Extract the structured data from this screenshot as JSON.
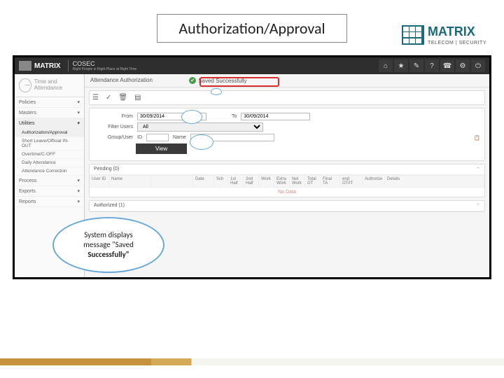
{
  "slide": {
    "title": "Authorization/Approval"
  },
  "brand": {
    "name": "MATRIX",
    "sub": "TELECOM | SECURITY"
  },
  "app": {
    "logo_name": "MATRIX",
    "product": "COSEC",
    "tagline": "Right People in Right Place at Right Time",
    "module_title": "Time and\nAttendance"
  },
  "top_icons": [
    "⌂",
    "★",
    "✎",
    "?",
    "☎",
    "⚙",
    "⏻"
  ],
  "sidebar": {
    "sections": [
      {
        "label": "Policies",
        "items": []
      },
      {
        "label": "Masters",
        "items": []
      },
      {
        "label": "Utilities",
        "active": true,
        "items": [
          {
            "label": "Authorization/Approval",
            "active": true
          },
          {
            "label": "Short Leave/Official IN-OUT"
          },
          {
            "label": "Overtime/C-OFF"
          },
          {
            "label": "Daily Attendance"
          },
          {
            "label": "Attendance Correction"
          }
        ]
      },
      {
        "label": "Process",
        "items": []
      },
      {
        "label": "Exports",
        "items": []
      },
      {
        "label": "Reports",
        "items": []
      }
    ]
  },
  "breadcrumb": "Attendance Authorization",
  "saved_msg": "Saved Successfully",
  "toolbar": [
    "☰",
    "✓",
    "🗑",
    "▤"
  ],
  "filters": {
    "from_label": "From",
    "from_value": "30/09/2014",
    "to_label": "To",
    "to_value": "30/09/2014",
    "filter_users_label": "Filter Users",
    "filter_users_value": "All",
    "group_user_label": "Group/User",
    "id_label": "ID",
    "name_label": "Name",
    "view_btn": "View"
  },
  "pending": {
    "title": "Pending (0)",
    "cols": [
      "User ID",
      "Name",
      "",
      "Date",
      "Sch",
      "1st Half",
      "2nd Half",
      "Work",
      "Extra Work",
      "Net Work",
      "Total OT",
      "Final TA",
      "end OT/IT",
      "Authorize",
      "Details"
    ],
    "nodata": "No Data"
  },
  "authorized": {
    "title": "Authorized (1)"
  },
  "callout": {
    "line1": "System displays",
    "line2": "message \"Saved",
    "line3": "Successfully\""
  }
}
